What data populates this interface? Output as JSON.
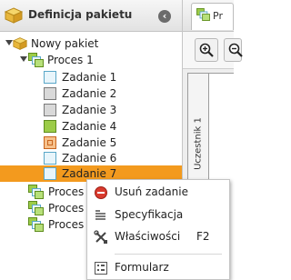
{
  "panel": {
    "title": "Definicja pakietu",
    "collapse_icon": "chevron-left-icon"
  },
  "tree": {
    "root_label": "Nowy pakiet",
    "process_label": "Proces 1",
    "tasks": [
      {
        "label": "Zadanie 1",
        "kind": "blue"
      },
      {
        "label": "Zadanie 2",
        "kind": "gray"
      },
      {
        "label": "Zadanie 3",
        "kind": "gray"
      },
      {
        "label": "Zadanie 4",
        "kind": "green"
      },
      {
        "label": "Zadanie 5",
        "kind": "orange"
      },
      {
        "label": "Zadanie 6",
        "kind": "blue"
      },
      {
        "label": "Zadanie 7",
        "kind": "blue",
        "selected": true
      }
    ],
    "collapsed_processes": [
      "Proces",
      "Proces",
      "Proces"
    ]
  },
  "right": {
    "tab_label": "Pr",
    "lane_label": "Uczestnik 1"
  },
  "context_menu": {
    "items": [
      {
        "label": "Usuń zadanie",
        "icon": "delete-icon"
      },
      {
        "label": "Specyfikacja",
        "icon": "document-icon"
      },
      {
        "label": "Właściwości",
        "icon": "tools-icon",
        "shortcut": "F2"
      },
      {
        "label": "Formularz",
        "icon": "form-icon"
      }
    ]
  },
  "colors": {
    "selection": "#f39a1e",
    "delete": "#d93a2e"
  }
}
